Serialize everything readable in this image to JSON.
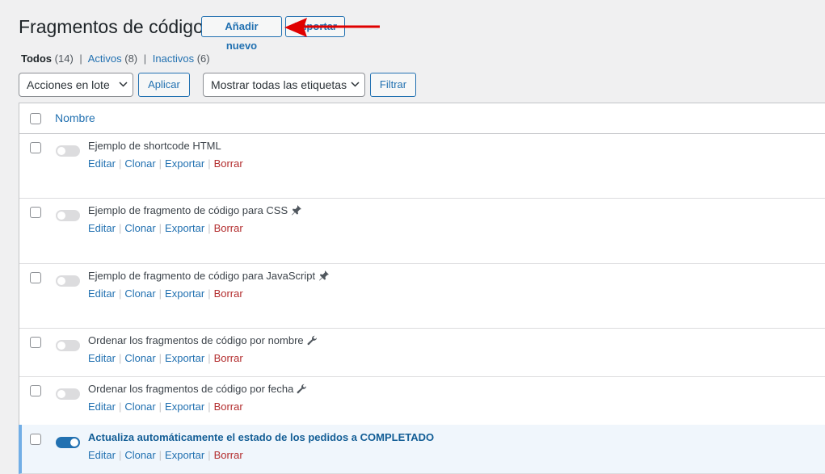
{
  "header": {
    "title": "Fragmentos de código",
    "add_new_label": "Añadir nuevo",
    "import_label": "Importar"
  },
  "filters": {
    "views": [
      {
        "label": "Todos",
        "count": "(14)"
      },
      {
        "label": "Activos",
        "count": "(8)"
      },
      {
        "label": "Inactivos",
        "count": "(6)"
      }
    ],
    "separator": "|",
    "bulk_actions": "Acciones en lote",
    "apply_label": "Aplicar",
    "tags_select": "Mostrar todas las etiquetas",
    "filter_label": "Filtrar"
  },
  "table": {
    "column_name": "Nombre",
    "action_labels": {
      "edit": "Editar",
      "clone": "Clonar",
      "export": "Exportar",
      "delete": "Borrar"
    },
    "rows": [
      {
        "name": "Ejemplo de shortcode HTML",
        "active": false,
        "icon": null
      },
      {
        "name": "Ejemplo de fragmento de código para CSS",
        "active": false,
        "icon": "pin-icon"
      },
      {
        "name": "Ejemplo de fragmento de código para JavaScript",
        "active": false,
        "icon": "pin-icon"
      },
      {
        "name": "Ordenar los fragmentos de código por nombre",
        "active": false,
        "icon": "wrench-icon"
      },
      {
        "name": "Ordenar los fragmentos de código por fecha",
        "active": false,
        "icon": "wrench-icon"
      },
      {
        "name": "Actualiza automáticamente el estado de los pedidos a COMPLETADO",
        "active": true,
        "icon": null
      }
    ]
  },
  "colors": {
    "accent": "#2271b1",
    "delete": "#b32d2e",
    "arrow": "#e00000"
  }
}
